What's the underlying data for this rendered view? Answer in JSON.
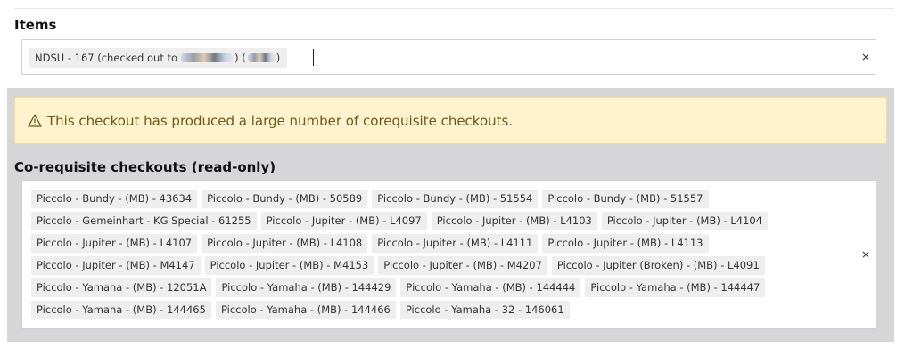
{
  "items": {
    "label": "Items",
    "chip_prefix": "NDSU - 167 (checked out to",
    "chip_mid": ") (",
    "chip_suffix": ")",
    "clear_symbol": "×"
  },
  "warning": {
    "icon": "warning-triangle-icon",
    "text": "This checkout has produced a large number of corequisite checkouts."
  },
  "corequisites": {
    "label": "Co-requisite checkouts (read-only)",
    "clear_symbol": "×",
    "rows": [
      [
        "Piccolo - Bundy - (MB) - 43634",
        "Piccolo - Bundy - (MB) - 50589",
        "Piccolo - Bundy - (MB) - 51554",
        "Piccolo - Bundy - (MB) - 51557"
      ],
      [
        "Piccolo - Gemeinhart - KG Special - 61255",
        "Piccolo - Jupiter - (MB) - L4097",
        "Piccolo - Jupiter - (MB) - L4103",
        "Piccolo - Jupiter - (MB) - L4104"
      ],
      [
        "Piccolo - Jupiter - (MB) - L4107",
        "Piccolo - Jupiter - (MB) - L4108",
        "Piccolo - Jupiter - (MB) - L4111",
        "Piccolo - Jupiter - (MB) - L4113"
      ],
      [
        "Piccolo - Jupiter - (MB) - M4147",
        "Piccolo - Jupiter - (MB) - M4153",
        "Piccolo - Jupiter - (MB) - M4207",
        "Piccolo - Jupiter (Broken) - (MB) - L4091"
      ],
      [
        "Piccolo - Yamaha - (MB) - 12051A",
        "Piccolo - Yamaha - (MB) - 144429",
        "Piccolo - Yamaha - (MB) - 144444",
        "Piccolo - Yamaha - (MB) - 144447"
      ],
      [
        "Piccolo - Yamaha - (MB) - 144465",
        "Piccolo - Yamaha - (MB) - 144466",
        "Piccolo - Yamaha - 32 - 146061"
      ]
    ]
  },
  "colors": {
    "warning_bg": "#fff3cd",
    "warning_text": "#6b5a1e",
    "panel_bg": "#d6d6d8",
    "chip_bg": "#eeeeee"
  }
}
